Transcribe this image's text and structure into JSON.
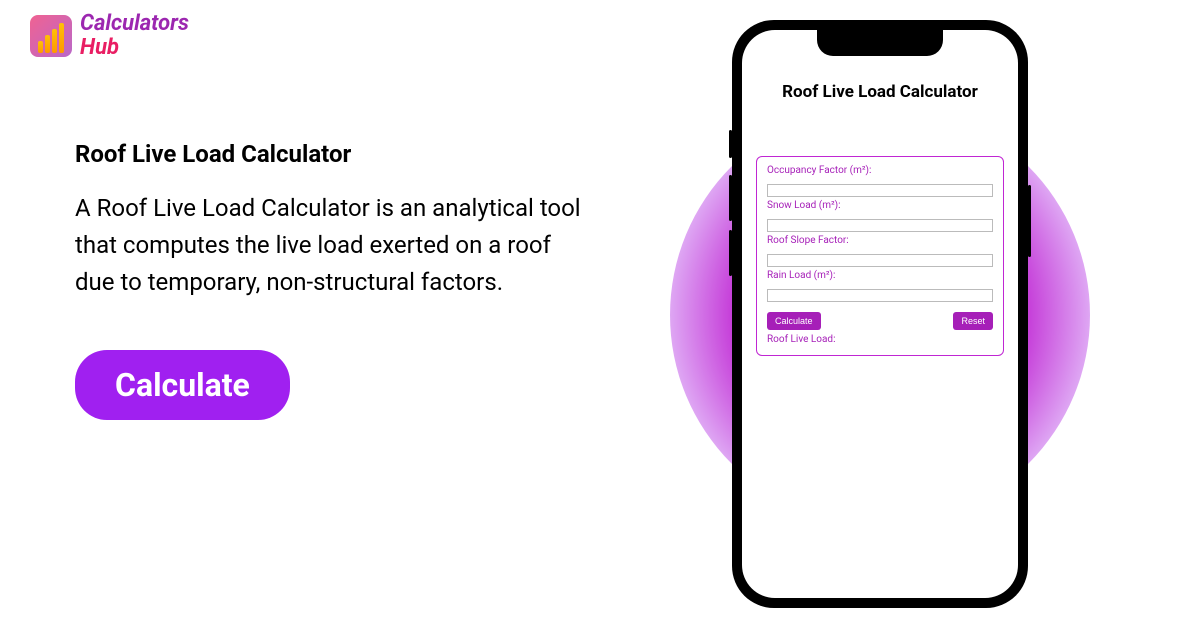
{
  "logo": {
    "text_top": "Calculators",
    "text_bottom": "Hub"
  },
  "main": {
    "title": "Roof Live Load Calculator",
    "description": "A Roof Live Load Calculator is an analytical tool that computes the live load exerted on a roof due to temporary, non-structural factors.",
    "calculate_button": "Calculate"
  },
  "app": {
    "title": "Roof Live Load Calculator",
    "form": {
      "occupancy_label": "Occupancy Factor (m²):",
      "snow_label": "Snow Load (m²):",
      "slope_label": "Roof Slope Factor:",
      "rain_label": "Rain Load (m²):",
      "calculate_button": "Calculate",
      "reset_button": "Reset",
      "result_label": "Roof Live Load:"
    }
  }
}
